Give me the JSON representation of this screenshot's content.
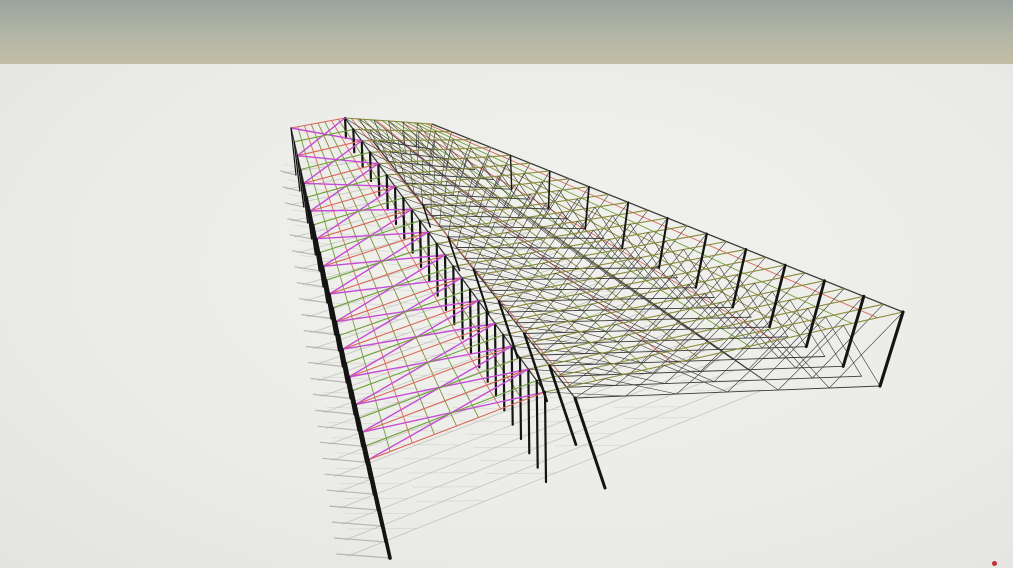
{
  "scene": {
    "subject": "steel-truss-warehouse-frame",
    "colors": {
      "sky_top": "#9aa39f",
      "sky_bottom": "#c2bea6",
      "ground": "#ecece9",
      "column": "#141414",
      "shadow": "#b9b9b6",
      "purlin_olive": "#8a8a3a",
      "purlin_green": "#6fa03a",
      "bracing_magenta": "#c64bd6",
      "chord_red": "#d86a5a",
      "web_dark": "#3a3a3a",
      "indicator": "#c0303a"
    },
    "icons": [
      "corner-indicator-icon"
    ]
  }
}
